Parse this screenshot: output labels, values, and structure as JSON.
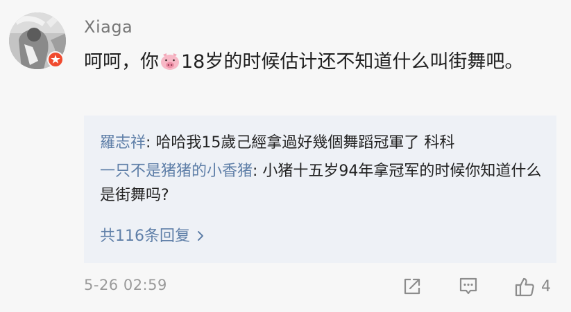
{
  "comment": {
    "username": "Xiaga",
    "text_before_emoji": "呵呵，你",
    "emoji": "pig-emoji",
    "text_after_emoji": "18岁的时候估计还不知道什么叫街舞吧。",
    "timestamp": "5-26 02:59",
    "like_count": "4"
  },
  "replies": [
    {
      "author": "羅志祥",
      "text": ": 哈哈我15歲己經拿過好幾個舞蹈冠軍了 科科"
    },
    {
      "author": "一只不是猪猪的小香猪",
      "text": ": 小猪十五岁94年拿冠军的时候你知道什么是街舞吗?"
    }
  ],
  "more_replies_label": "共116条回复",
  "icons": {
    "avatar": "user-avatar",
    "badge": "vip-badge-icon",
    "share": "share-icon",
    "comment": "comment-icon",
    "like": "thumbs-up-icon",
    "more": "chevron-right-icon"
  },
  "colors": {
    "link": "#5f7fa8",
    "reply_bg": "#eef1f6",
    "badge": "#f04a2e",
    "muted": "#9a9a9a"
  }
}
